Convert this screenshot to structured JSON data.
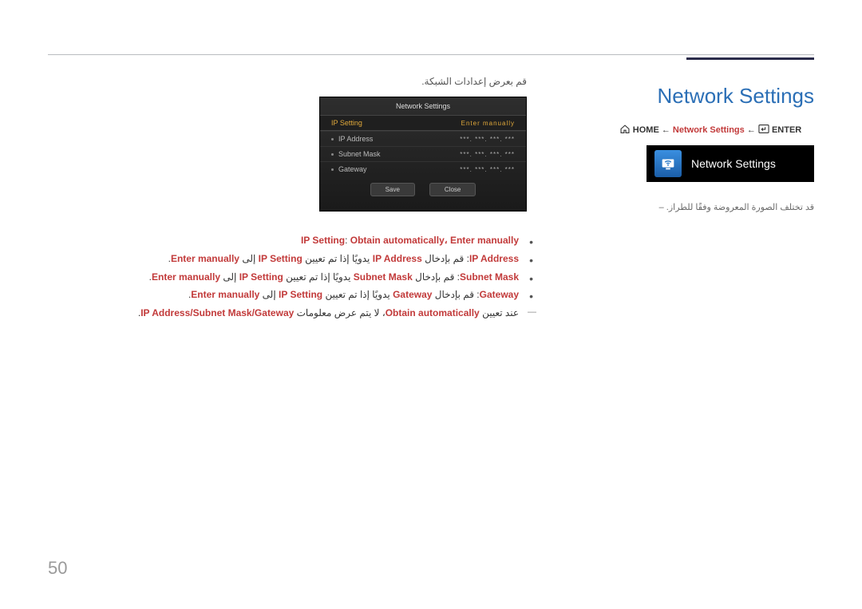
{
  "page_number": "50",
  "right": {
    "section_title": "Network Settings",
    "breadcrumb": {
      "enter": "ENTER",
      "arrow": "←",
      "mid": "Network Settings",
      "home": "HOME"
    },
    "tile_label": "Network Settings",
    "note": "قد تختلف الصورة المعروضة وفقًا للطراز."
  },
  "left": {
    "lead_ar": "قم بعرض إعدادات الشبكة.",
    "mock": {
      "title": "Network Settings",
      "header_label": "IP Setting",
      "header_value": "Enter manually",
      "rows": [
        {
          "label": "IP Address",
          "value": "***.   ***.   ***.   ***"
        },
        {
          "label": "Subnet Mask",
          "value": "***.   ***.   ***.   ***"
        },
        {
          "label": "Gateway",
          "value": "***.   ***.   ***.   ***"
        }
      ],
      "btn_save": "Save",
      "btn_close": "Close"
    },
    "bullets": {
      "b1_pre": "IP Setting",
      "b1_red": "Obtain automatically، Enter manually",
      "b2_lbl": "IP Address",
      "b2_txt1": ": قم بإدخال ",
      "b2_red1": "IP Address",
      "b2_txt2": " يدويًا إذا تم تعيين ",
      "b2_red2": "IP Setting",
      "b2_txt3": " إلى ",
      "b2_red3": "Enter manually",
      "b3_lbl": "Subnet Mask",
      "b3_txt1": ": قم بإدخال ",
      "b3_red1": "Subnet Mask",
      "b3_txt2": " يدويًا إذا تم تعيين ",
      "b3_red2": "IP Setting",
      "b3_txt3": " إلى ",
      "b3_red3": "Enter manually",
      "b4_lbl": "Gateway",
      "b4_txt1": ": قم بإدخال ",
      "b4_red1": "Gateway",
      "b4_txt2": " يدويًا إذا تم تعيين ",
      "b4_red2": "IP Setting",
      "b4_txt3": " إلى ",
      "b4_red3": "Enter manually",
      "dash_txt1": "عند تعيين ",
      "dash_red1": "Obtain automatically",
      "dash_txt2": "، لا يتم عرض معلومات ",
      "dash_red2": "IP Address/Subnet Mask/Gateway",
      "dash_txt3": "."
    }
  }
}
